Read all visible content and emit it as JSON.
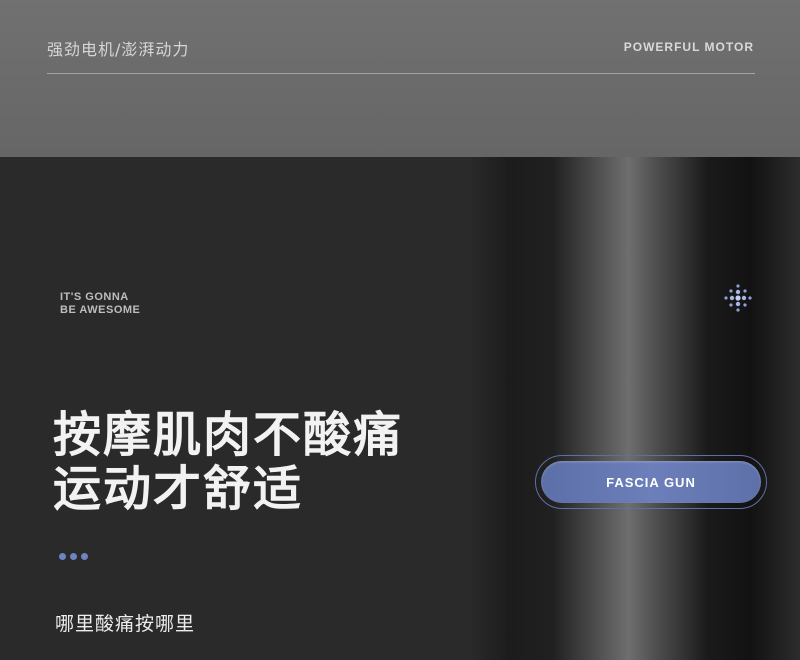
{
  "header": {
    "left_text": "强劲电机/澎湃动力",
    "right_text": "POWERFUL MOTOR"
  },
  "tagline": {
    "line1": "IT'S GONNA",
    "line2": "BE AWESOME"
  },
  "headline": {
    "line1": "按摩肌肉不酸痛",
    "line2": "运动才舒适"
  },
  "subline": "哪里酸痛按哪里",
  "badge": {
    "label": "FASCIA GUN"
  },
  "colors": {
    "accent": "#6e83c2",
    "top_band": "#6d6d6d",
    "background": "#2b2b2c"
  }
}
